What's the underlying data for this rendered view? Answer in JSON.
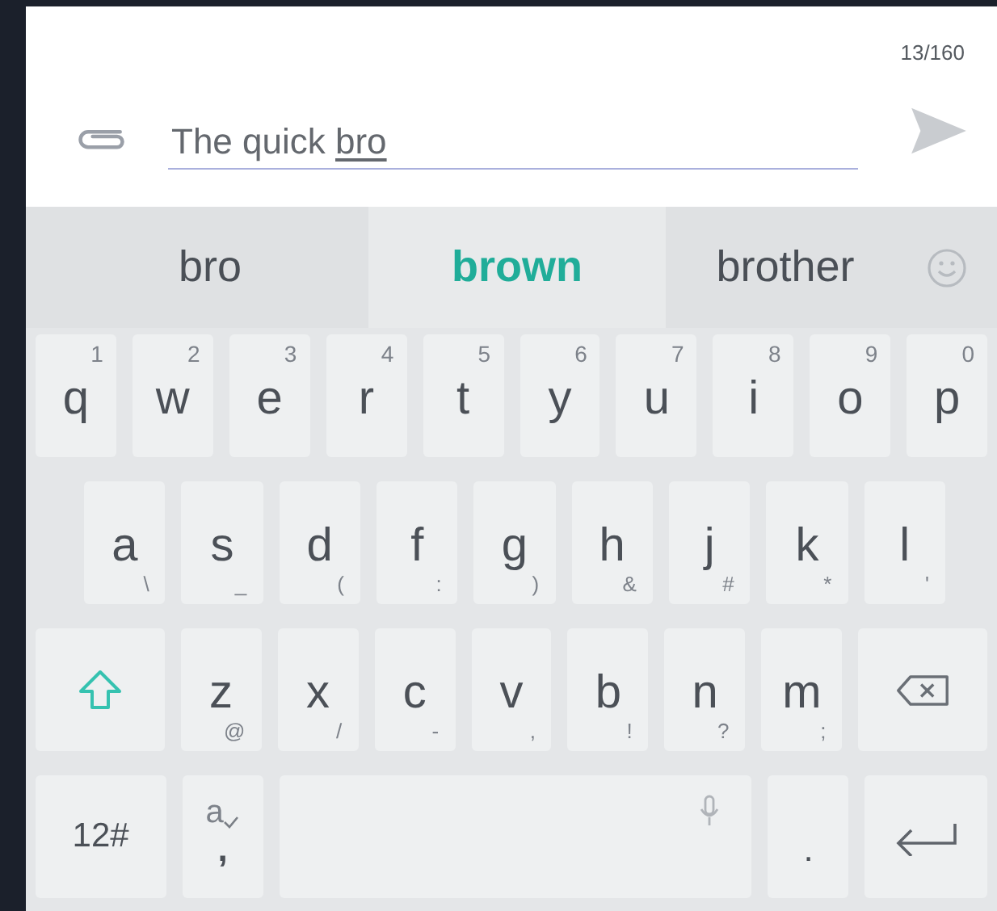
{
  "message": {
    "counter": "13/160",
    "text": "The quick ",
    "composing": "bro"
  },
  "suggestions": [
    {
      "text": "bro",
      "selected": false
    },
    {
      "text": "brown",
      "selected": true
    },
    {
      "text": "brother",
      "selected": false
    }
  ],
  "keyboard": {
    "rows": [
      {
        "keys": [
          {
            "kind": "letter",
            "label": "q",
            "hint": "1"
          },
          {
            "kind": "letter",
            "label": "w",
            "hint": "2"
          },
          {
            "kind": "letter",
            "label": "e",
            "hint": "3"
          },
          {
            "kind": "letter",
            "label": "r",
            "hint": "4"
          },
          {
            "kind": "letter",
            "label": "t",
            "hint": "5"
          },
          {
            "kind": "letter",
            "label": "y",
            "hint": "6"
          },
          {
            "kind": "letter",
            "label": "u",
            "hint": "7"
          },
          {
            "kind": "letter",
            "label": "i",
            "hint": "8"
          },
          {
            "kind": "letter",
            "label": "o",
            "hint": "9"
          },
          {
            "kind": "letter",
            "label": "p",
            "hint": "0"
          }
        ]
      },
      {
        "keys": [
          {
            "kind": "letter",
            "label": "a",
            "hint": "\\"
          },
          {
            "kind": "letter",
            "label": "s",
            "hint": "_"
          },
          {
            "kind": "letter",
            "label": "d",
            "hint": "("
          },
          {
            "kind": "letter",
            "label": "f",
            "hint": ":"
          },
          {
            "kind": "letter",
            "label": "g",
            "hint": ")"
          },
          {
            "kind": "letter",
            "label": "h",
            "hint": "&"
          },
          {
            "kind": "letter",
            "label": "j",
            "hint": "#"
          },
          {
            "kind": "letter",
            "label": "k",
            "hint": "*"
          },
          {
            "kind": "letter",
            "label": "l",
            "hint": "'"
          }
        ]
      },
      {
        "keys": [
          {
            "kind": "shift",
            "active": true
          },
          {
            "kind": "letter",
            "label": "z",
            "hint": "@"
          },
          {
            "kind": "letter",
            "label": "x",
            "hint": "/"
          },
          {
            "kind": "letter",
            "label": "c",
            "hint": "-"
          },
          {
            "kind": "letter",
            "label": "v",
            "hint": ","
          },
          {
            "kind": "letter",
            "label": "b",
            "hint": "!"
          },
          {
            "kind": "letter",
            "label": "n",
            "hint": "?"
          },
          {
            "kind": "letter",
            "label": "m",
            "hint": ";"
          },
          {
            "kind": "backspace"
          }
        ]
      },
      {
        "keys": [
          {
            "kind": "symbols",
            "label": "12#"
          },
          {
            "kind": "comma",
            "label": ",",
            "hint": "a"
          },
          {
            "kind": "space"
          },
          {
            "kind": "period",
            "label": "."
          },
          {
            "kind": "enter"
          }
        ]
      }
    ]
  }
}
